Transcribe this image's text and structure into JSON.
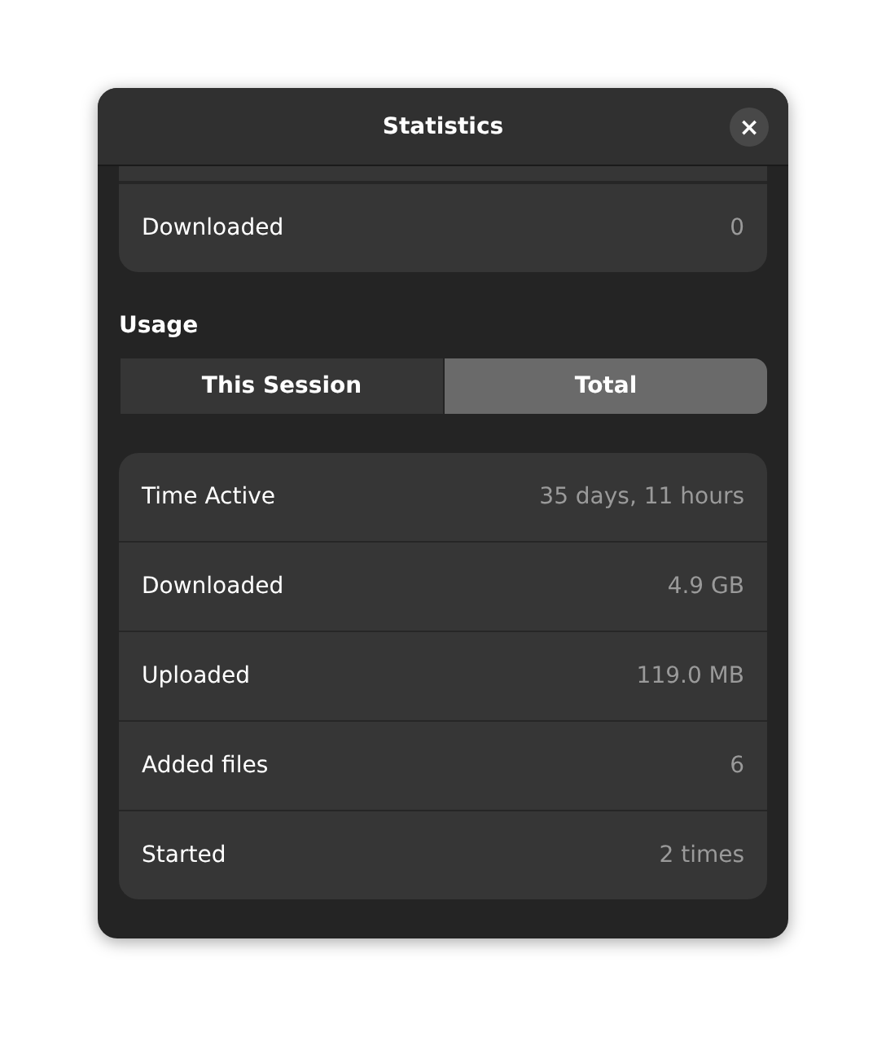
{
  "window": {
    "title": "Statistics",
    "close_icon": "×"
  },
  "partial_card": {
    "rows": [
      {
        "label": "Downloaded",
        "value": "0"
      }
    ]
  },
  "usage": {
    "heading": "Usage",
    "toggle": [
      {
        "label": "This Session",
        "selected": false
      },
      {
        "label": "Total",
        "selected": true
      }
    ],
    "rows": [
      {
        "label": "Time Active",
        "value": "35 days, 11 hours"
      },
      {
        "label": "Downloaded",
        "value": "4.9 GB"
      },
      {
        "label": "Uploaded",
        "value": "119.0 MB"
      },
      {
        "label": "Added files",
        "value": "6"
      },
      {
        "label": "Started",
        "value": "2 times"
      }
    ]
  }
}
